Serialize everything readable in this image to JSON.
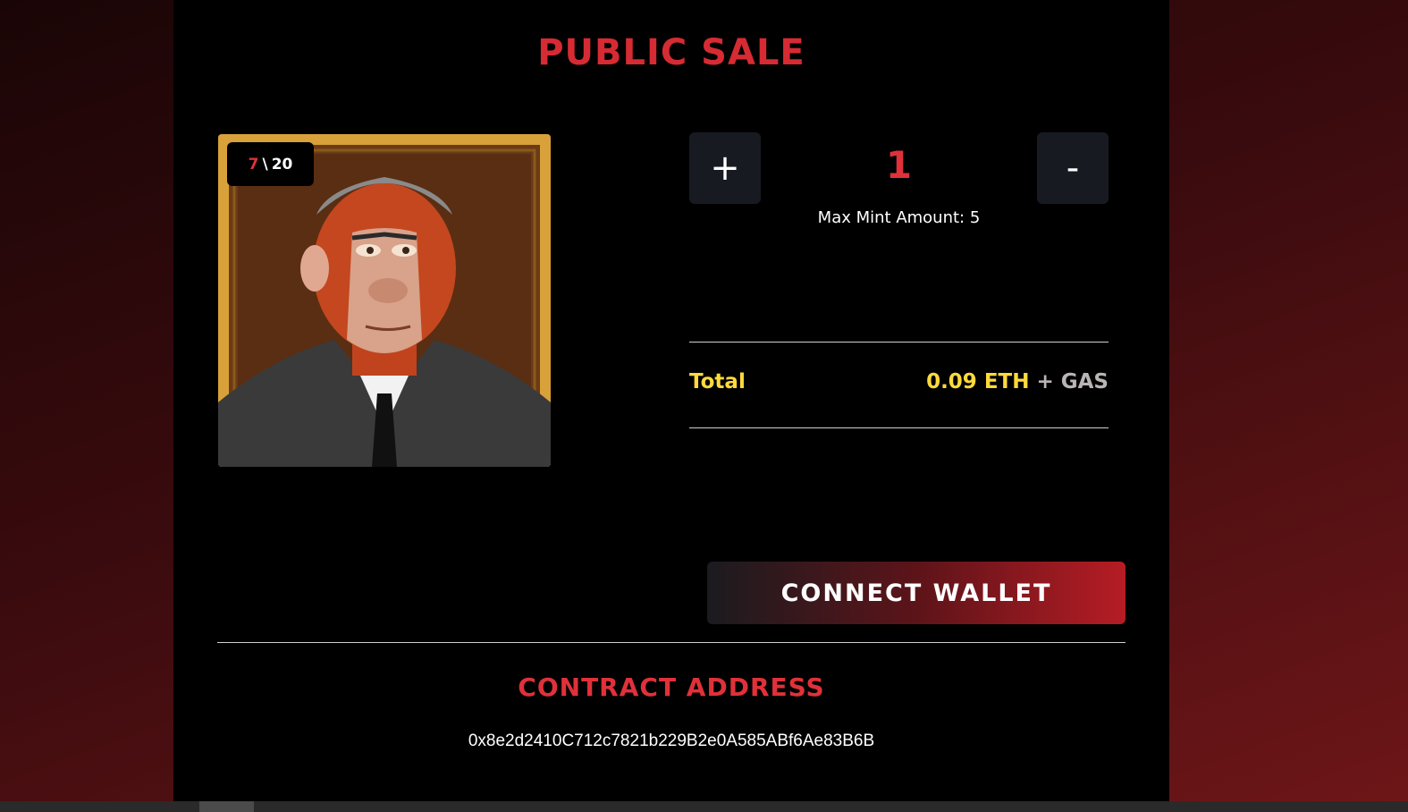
{
  "header": {
    "title": "PUBLIC SALE"
  },
  "art": {
    "minted": "7",
    "separator": "\\",
    "supply": "20"
  },
  "mint": {
    "plus_label": "+",
    "minus_label": "-",
    "quantity": "1",
    "max_mint_text": "Max Mint Amount: 5"
  },
  "total": {
    "label": "Total",
    "price": "0.09 ETH",
    "plus": "+",
    "gas": "GAS"
  },
  "connect": {
    "label": "CONNECT WALLET"
  },
  "contract": {
    "title": "CONTRACT ADDRESS",
    "address": "0x8e2d2410C712c7821b229B2e0A585ABf6Ae83B6B"
  },
  "colors": {
    "accent_red": "#e0313a",
    "accent_yellow": "#ffd93d",
    "panel_bg": "#000000",
    "button_bg": "#171b21"
  },
  "icons": [
    "plus-icon",
    "minus-icon"
  ]
}
